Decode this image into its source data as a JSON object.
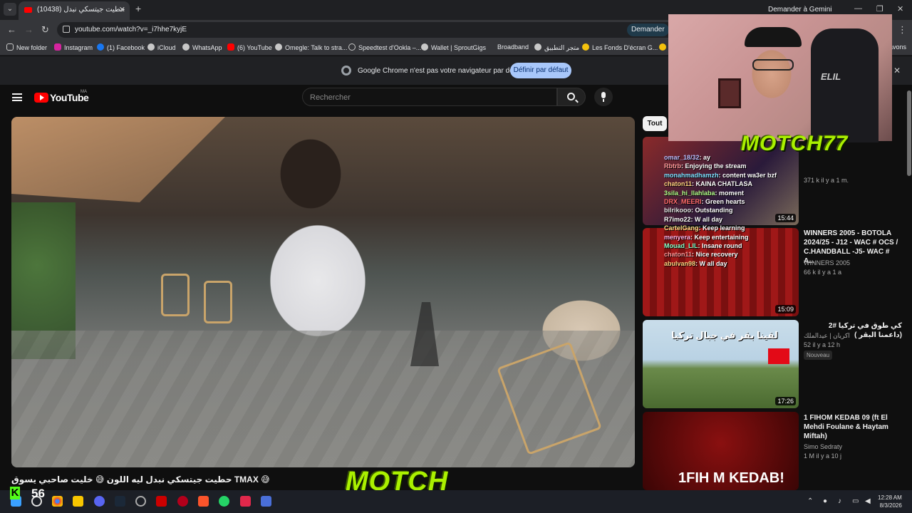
{
  "browser": {
    "tab_title": "(10438) حطيت جيتسكي نبدل",
    "new_tab": "+",
    "gemini_label": "Demander à Gemini",
    "gemini_short": "Demander",
    "url": "youtube.com/watch?v=_i7hhe7kyjE",
    "bookmarks": [
      "New folder",
      "Instagram",
      "(1) Facebook",
      "iCloud",
      "WhatsApp",
      "(6) YouTube",
      "Omegle: Talk to stra...",
      "Speedtest d'Ookla –...",
      "Wallet | SproutGigs",
      "Broadband",
      "متجر التطبيق",
      "Les Fonds D'écran G...",
      "Le",
      "avons"
    ],
    "infobar_text": "Google Chrome n'est pas votre navigateur par défaut",
    "infobar_button": "Définir par défaut",
    "colors": {
      "infobar_button": "#a8c7fa",
      "brand": "#ff0000"
    }
  },
  "youtube": {
    "logo_text": "YouTube",
    "country": "MA",
    "search_placeholder": "Rechercher",
    "filter_chip": "Tout",
    "video_title": "حطيت جيتسكي نبدل ليه اللون 😅 خليت صاحبي يسوق TMAX 😅",
    "recommendations": [
      {
        "title": "",
        "channel": "",
        "meta": "371 k  il y a 1 m.",
        "duration": "15:44"
      },
      {
        "title": "WINNERS 2005 - BOTOLA 2024/25 - J12 - WAC # OCS / C.HANDBALL -J5- WAC # A...",
        "channel": "WINNERS 2005",
        "meta": "66 k  il y a 1 a",
        "duration": "15:09"
      },
      {
        "title": "2# كي طوق في تركيا (داعمنا البقر )",
        "channel": "اكريان | عيدالملك",
        "meta": "52  il y a 12 h",
        "badge": "Nouveau",
        "duration": "17:26",
        "thumb_text": "لقينا بقر في جبال تركيا"
      },
      {
        "title": "1 FIHOM KEDAB 09 (ft El Mehdi Foulane & Haytam Miftah)",
        "channel": "Simo Sedraty",
        "meta": "1 M  il y a 10 j",
        "thumb_text": "1FIH  M KEDAB!"
      }
    ]
  },
  "overlay": {
    "chat": [
      {
        "user": "omar_18/32",
        "msg": ": ay"
      },
      {
        "user": "Rbtrb",
        "msg": ": Enjoying the stream"
      },
      {
        "user": "monahmadhamzh",
        "msg": ": content wa3er bzf"
      },
      {
        "user": "chaton11",
        "msg": ": KAINA CHATLASA"
      },
      {
        "user": "3sila_hi_llahlaba",
        "msg": ": moment"
      },
      {
        "user": "DRX_MEERI",
        "msg": ": Green hearts"
      },
      {
        "user": "bilrikooo",
        "msg": ": Outstanding"
      },
      {
        "user": "R7imo22",
        "msg": ": W all day"
      },
      {
        "user": "CartelGang",
        "msg": ": Keep learning"
      },
      {
        "user": "menyera",
        "msg": ": Keep entertaining"
      },
      {
        "user": "Mouad_LIL",
        "msg": ": Insane round"
      },
      {
        "user": "chaton11",
        "msg": ": Nice recovery"
      },
      {
        "user": "abulvan98",
        "msg": ": W all day"
      }
    ],
    "brand": "MOTCH",
    "motch_small": "MOTCH77",
    "chair_text": "ELIL",
    "viewer_count": "56",
    "kick_letter": "K",
    "colors": {
      "brand": "#aaf000",
      "kick": "#53fc18"
    }
  },
  "taskbar": {
    "time": "12:28 AM",
    "date": "8/3/2026"
  }
}
